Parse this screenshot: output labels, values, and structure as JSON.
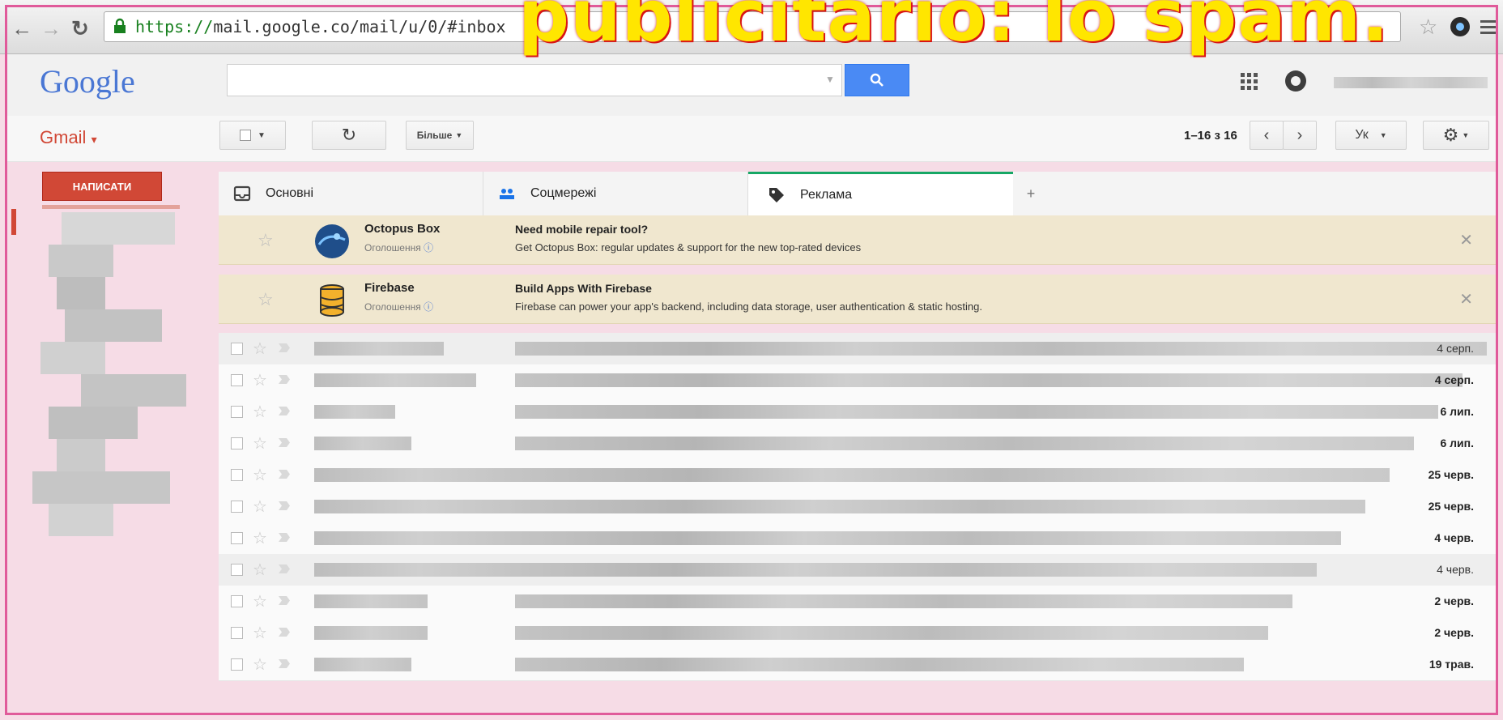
{
  "overlay": {
    "title": "publicitario: lo spam."
  },
  "browser": {
    "back_icon": "back-arrow-icon",
    "forward_icon": "forward-arrow-icon",
    "reload_icon": "reload-icon",
    "url_scheme": "https://",
    "url_host": "mail.google.co",
    "url_path": "/mail/u/0/#inbox"
  },
  "header": {
    "logo": "Google",
    "search_placeholder": "",
    "accent_color": "#4a8af4"
  },
  "toolbar": {
    "gmail_label": "Gmail",
    "more_label": "Більше",
    "pager": "1–16 з 16",
    "lang": "Ук"
  },
  "sidebar": {
    "compose_label": "НАПИСАТИ"
  },
  "tabs": [
    {
      "label": "Основні",
      "icon": "inbox-icon"
    },
    {
      "label": "Соцмережі",
      "icon": "people-icon"
    },
    {
      "label": "Реклама",
      "icon": "tag-icon",
      "active": true
    },
    {
      "label": "+",
      "icon": "add-tab-icon"
    }
  ],
  "ads": [
    {
      "sender": "Octopus Box",
      "tag": "Оголошення",
      "subject": "Need mobile repair tool?",
      "body": "Get Octopus Box: regular updates & support for the new top-rated devices"
    },
    {
      "sender": "Firebase",
      "tag": "Оголошення",
      "subject": "Build Apps With Firebase",
      "body": "Firebase can power your app's backend, including data storage, user authentication & static hosting."
    }
  ],
  "mails": [
    {
      "date": "4 серп.",
      "read": true
    },
    {
      "date": "4 серп.",
      "read": false
    },
    {
      "date": "6 лип.",
      "read": false
    },
    {
      "date": "6 лип.",
      "read": false
    },
    {
      "date": "25 черв.",
      "read": false
    },
    {
      "date": "25 черв.",
      "read": false
    },
    {
      "date": "4 черв.",
      "read": false
    },
    {
      "date": "4 черв.",
      "read": true
    },
    {
      "date": "2 черв.",
      "read": false
    },
    {
      "date": "2 черв.",
      "read": false
    },
    {
      "date": "19 трав.",
      "read": false
    }
  ]
}
